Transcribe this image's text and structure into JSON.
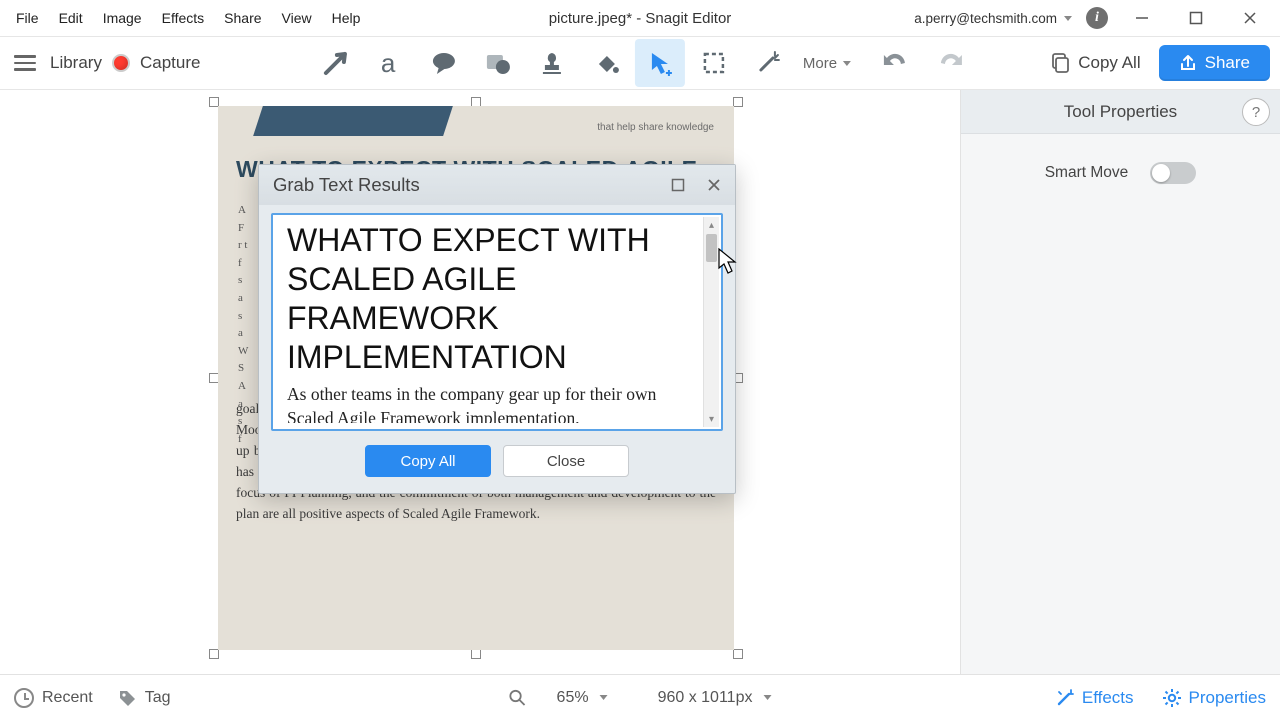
{
  "menubar": {
    "items": [
      "File",
      "Edit",
      "Image",
      "Effects",
      "Share",
      "View",
      "Help"
    ],
    "title": "picture.jpeg* - Snagit Editor",
    "account": "a.perry@techsmith.com"
  },
  "toolbar": {
    "library_label": "Library",
    "capture_label": "Capture",
    "more_label": "More",
    "copy_all_label": "Copy All",
    "share_label": "Share"
  },
  "properties": {
    "title": "Tool Properties",
    "help": "?",
    "smart_move_label": "Smart Move",
    "smart_move_on": false
  },
  "document": {
    "top_tag": "that help share knowledge",
    "heading": "WHAT TO EXPECT WITH SCALED AGILE",
    "body_lower": "goals. The two-day PI planning event was regarded as long but beneficial with Moonshine Torpedo members saying that it is helpful and necessary even though it ends up being a long two days. Finally, Moonshine Torpedo members assert that the change has been positive overall but does need more adapting. The emphasis on quality, the focus of PI Planning, and the commitment of both management and development to the plan are all positive aspects of Scaled Agile Framework.",
    "left_letters": "A F r t f s a s a W S A a s f"
  },
  "dialog": {
    "title": "Grab Text Results",
    "heading": "WHATTO EXPECT WITH SCALED AGILE FRAMEWORK IMPLEMENTATION",
    "paragraph": "As other teams in the company gear up for their own Scaled Agile Framework implementation,",
    "copy_all": "Copy All",
    "close": "Close"
  },
  "statusbar": {
    "recent": "Recent",
    "tag": "Tag",
    "zoom": "65%",
    "dimensions": "960 x 1011px",
    "effects": "Effects",
    "properties": "Properties"
  }
}
